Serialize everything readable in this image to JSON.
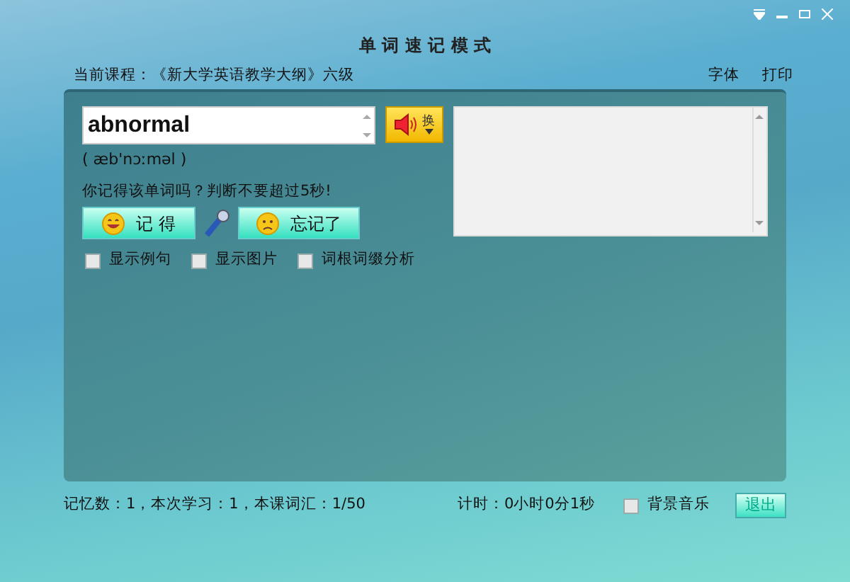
{
  "window": {
    "title": "单 词 速 记 模 式"
  },
  "header": {
    "course": "当前课程：《新大学英语教学大纲》六级",
    "links": [
      "字体",
      "打印"
    ]
  },
  "word": {
    "value": "abnormal",
    "phonetic": "( æb'nɔːməl )",
    "switch_label": "换"
  },
  "prompt": "你记得该单词吗？判断不要超过5秒!",
  "answers": [
    {
      "kind": "happy",
      "label": "记  得"
    },
    {
      "kind": "sad",
      "label": "忘记了"
    }
  ],
  "options": [
    {
      "label": "显示例句",
      "checked": false
    },
    {
      "label": "显示图片",
      "checked": false
    },
    {
      "label": "词根词缀分析",
      "checked": false
    }
  ],
  "status_bar": {
    "stats": "记忆数：1，本次学习：1，本课词汇：1/50",
    "timer": "计时：0小时0分1秒",
    "music": {
      "label": "背景音乐",
      "checked": false
    },
    "exit": "退出"
  }
}
